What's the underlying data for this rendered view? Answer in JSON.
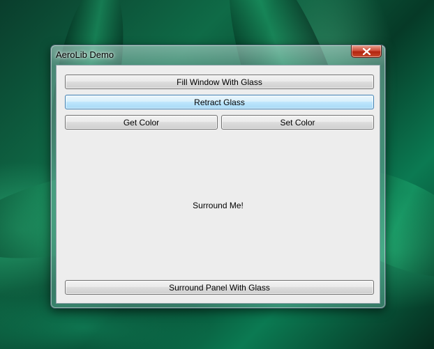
{
  "window": {
    "title": "AeroLib Demo"
  },
  "buttons": {
    "fill_window": "Fill Window With Glass",
    "retract_glass": "Retract Glass",
    "get_color": "Get Color",
    "set_color": "Set Color",
    "surround_panel": "Surround Panel With Glass"
  },
  "panel": {
    "label": "Surround Me!"
  },
  "icons": {
    "close": "close-icon"
  },
  "colors": {
    "hover_button": "#bee6fd",
    "close_button": "#c84a2e"
  }
}
